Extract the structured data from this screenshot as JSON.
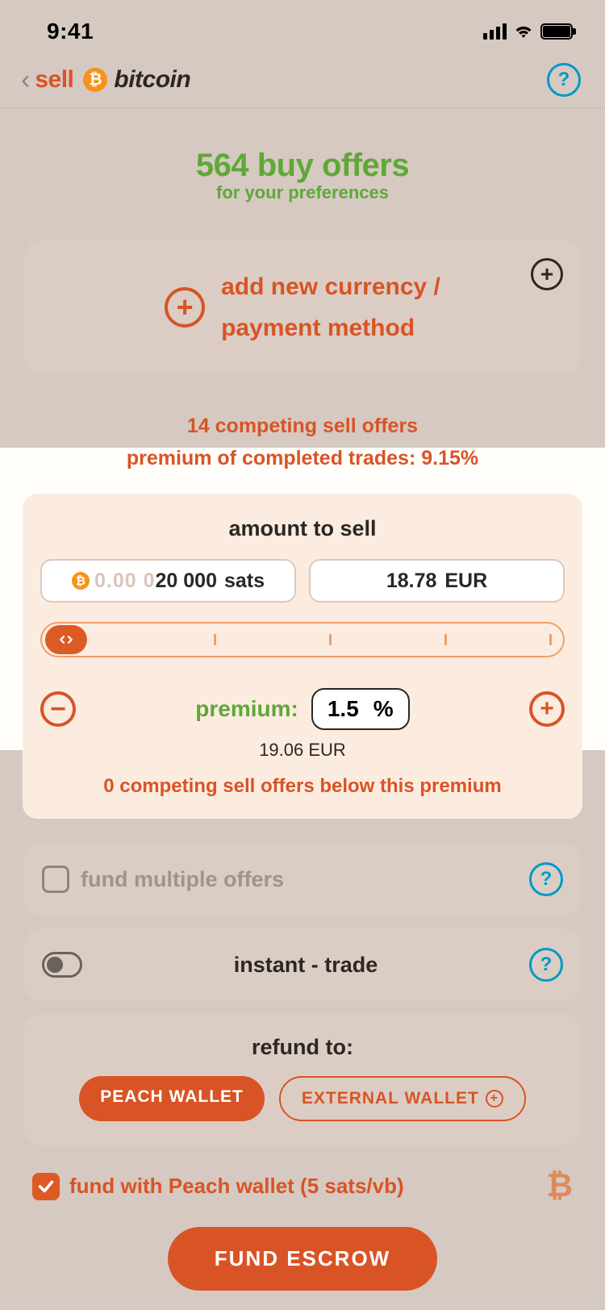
{
  "status": {
    "time": "9:41"
  },
  "header": {
    "action": "sell",
    "brand": "bitcoin"
  },
  "hero": {
    "count_line": "564 buy offers",
    "sub": "for your preferences"
  },
  "add_method": {
    "line1": "add new currency /",
    "line2": "payment method"
  },
  "stats": {
    "competing": "14 competing sell offers",
    "avg_premium": "premium of completed trades: 9.15%"
  },
  "amount": {
    "title": "amount to sell",
    "sats_faint": "0.00 0",
    "sats_value": "20 000",
    "sats_unit": "sats",
    "fiat_value": "18.78",
    "fiat_unit": "EUR"
  },
  "premium": {
    "label": "premium:",
    "value": "1.5",
    "unit": "%",
    "with_premium": "19.06 EUR",
    "note": "0 competing sell offers below this premium"
  },
  "fund_multiple": {
    "label": "fund multiple offers"
  },
  "instant": {
    "label": "instant - trade"
  },
  "refund": {
    "title": "refund to:",
    "peach": "PEACH WALLET",
    "external": "EXTERNAL WALLET"
  },
  "fund_with": {
    "label": "fund with Peach wallet (5 sats/vb)"
  },
  "cta": {
    "label": "FUND ESCROW"
  }
}
